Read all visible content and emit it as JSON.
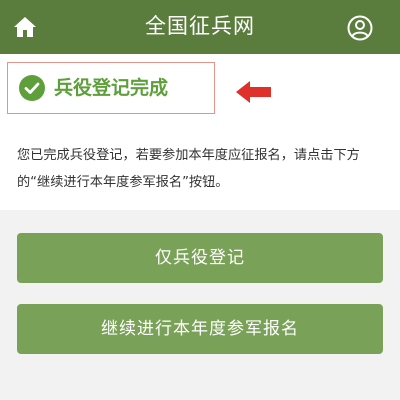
{
  "header": {
    "title": "全国征兵网",
    "home_icon": "home-icon",
    "user_icon": "user-icon"
  },
  "status": {
    "text": "兵役登记完成",
    "icon": "check-circle-icon",
    "color": "#5e9f3c"
  },
  "description": "您已完成兵役登记，若要参加本年度应征报名，请点击下方的“继续进行本年度参军报名”按钮。",
  "buttons": {
    "register_only": "仅兵役登记",
    "continue_enlist": "继续进行本年度参军报名"
  },
  "colors": {
    "header": "#5a7d3e",
    "button": "#7aa158",
    "highlight_border": "#e3948d",
    "arrow": "#e0302a"
  }
}
